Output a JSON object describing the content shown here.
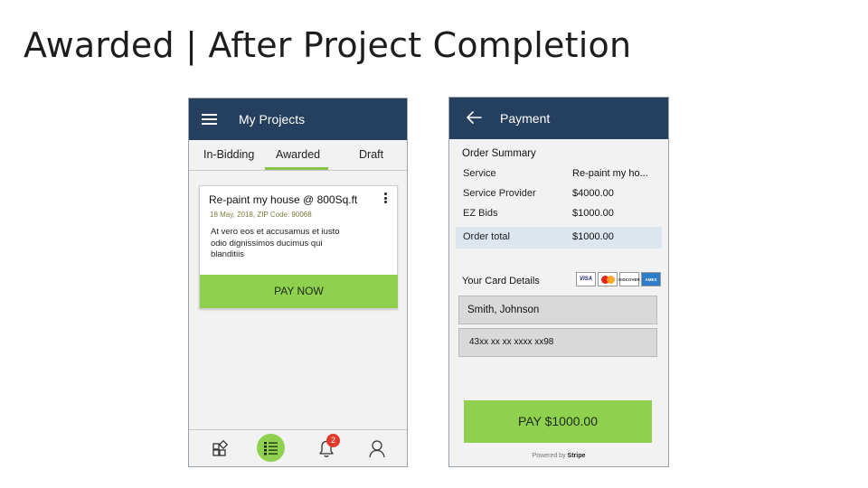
{
  "slide": {
    "title": "Awarded | After Project Completion"
  },
  "projects_screen": {
    "appbar": {
      "title": "My Projects",
      "menu_icon": "hamburger-menu-icon"
    },
    "tabs": [
      {
        "label": "In-Bidding",
        "active": false
      },
      {
        "label": "Awarded",
        "active": true
      },
      {
        "label": "Draft",
        "active": false
      }
    ],
    "accent_color": "#8fd14f",
    "header_color": "#253f5e",
    "project_card": {
      "title": "Re-paint my house @ 800Sq.ft",
      "meta": "18 May, 2018, ZIP Code: 90068",
      "description": "At vero eos et accusamus et iusto odio dignissimos ducimus qui blanditiis",
      "pay_button": "PAY NOW"
    },
    "bottom_nav": [
      {
        "icon": "dashboard-icon"
      },
      {
        "icon": "list-icon",
        "active": true
      },
      {
        "icon": "bell-icon",
        "badge": "2"
      },
      {
        "icon": "user-icon"
      }
    ]
  },
  "payment_screen": {
    "appbar": {
      "title": "Payment",
      "back_icon": "back-arrow-icon"
    },
    "order_summary": {
      "heading": "Order Summary",
      "rows": [
        {
          "label": "Service",
          "value": "Re-paint my ho..."
        },
        {
          "label": "Service Provider",
          "value": "$4000.00"
        },
        {
          "label": "EZ Bids",
          "value": "$1000.00"
        }
      ],
      "total": {
        "label": "Order total",
        "value": "$1000.00"
      }
    },
    "card_details": {
      "heading": "Your Card Details",
      "logos": [
        "VISA",
        "MasterCard",
        "DISCOVER",
        "AMERICAN EXPRESS"
      ],
      "name_value": "Smith, Johnson",
      "card_number_value": "43xx xx xx xxxx xx98"
    },
    "pay_button": "PAY $1000.00",
    "powered_by": {
      "prefix": "Powered by",
      "brand": "Stripe"
    }
  }
}
